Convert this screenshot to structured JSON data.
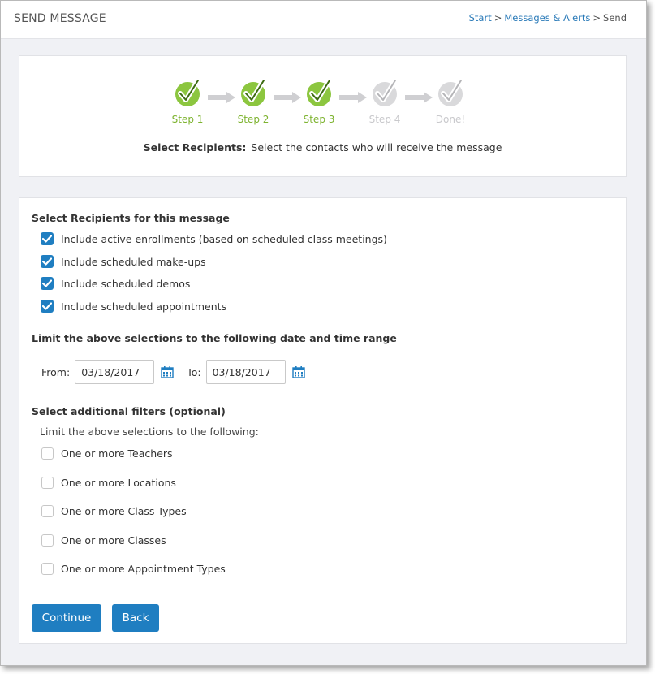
{
  "header": {
    "title": "SEND MESSAGE",
    "breadcrumb": [
      {
        "label": "Start",
        "link": true
      },
      {
        "label": "Messages & Alerts",
        "link": true
      },
      {
        "label": "Send",
        "link": false
      }
    ],
    "breadcrumb_separator": ">"
  },
  "wizard": {
    "steps": [
      {
        "label": "Step 1",
        "status": "complete"
      },
      {
        "label": "Step 2",
        "status": "complete"
      },
      {
        "label": "Step 3",
        "status": "complete"
      },
      {
        "label": "Step 4",
        "status": "pending"
      },
      {
        "label": "Done!",
        "status": "pending"
      }
    ],
    "description_label": "Select Recipients:",
    "description_text": "Select the contacts who will receive the message"
  },
  "recipients": {
    "title": "Select Recipients for this message",
    "options": [
      {
        "label": "Include active enrollments (based on scheduled class meetings)",
        "checked": true
      },
      {
        "label": "Include scheduled make-ups",
        "checked": true
      },
      {
        "label": "Include scheduled demos",
        "checked": true
      },
      {
        "label": "Include scheduled appointments",
        "checked": true
      }
    ]
  },
  "date_range": {
    "title": "Limit the above selections to the following date and time range",
    "from_label": "From:",
    "from_value": "03/18/2017",
    "to_label": "To:",
    "to_value": "03/18/2017"
  },
  "filters": {
    "title": "Select additional filters (optional)",
    "subtitle": "Limit the above selections to the following:",
    "options": [
      {
        "label": "One or more Teachers",
        "checked": false
      },
      {
        "label": "One or more Locations",
        "checked": false
      },
      {
        "label": "One or more Class Types",
        "checked": false
      },
      {
        "label": "One or more Classes",
        "checked": false
      },
      {
        "label": "One or more Appointment Types",
        "checked": false
      }
    ]
  },
  "buttons": {
    "continue": "Continue",
    "back": "Back"
  },
  "colors": {
    "primary": "#1f7ec1",
    "step_complete": "#8cc63f",
    "step_pending": "#d9d9db",
    "link": "#2a7ab8"
  }
}
